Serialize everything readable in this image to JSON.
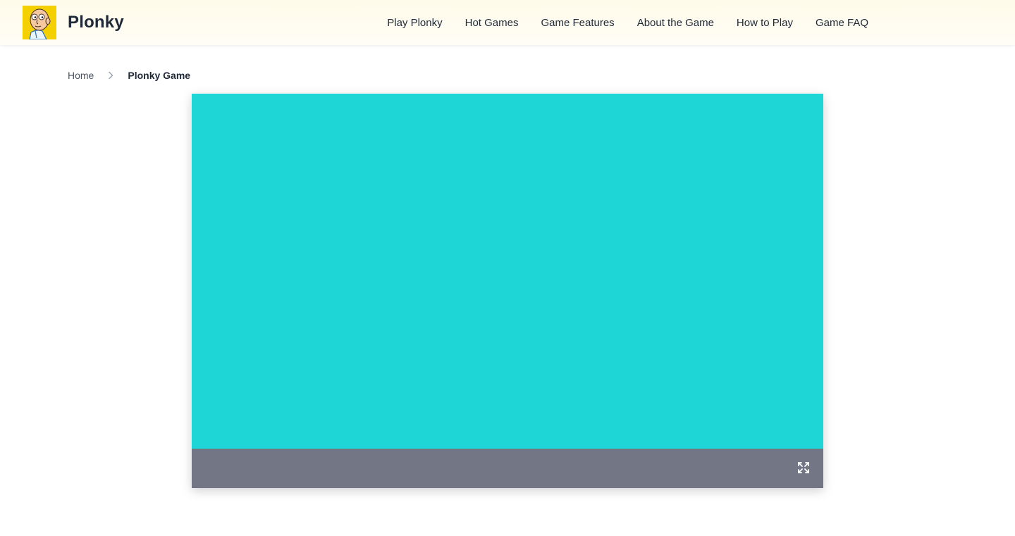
{
  "site": {
    "brand": "Plonky",
    "logo_icon": "plonky-character-logo",
    "logo_bg_color": "#f5d000"
  },
  "nav": {
    "items": [
      {
        "label": "Play Plonky"
      },
      {
        "label": "Hot Games"
      },
      {
        "label": "Game Features"
      },
      {
        "label": "About the Game"
      },
      {
        "label": "How to Play"
      },
      {
        "label": "Game FAQ"
      }
    ]
  },
  "breadcrumb": {
    "home": "Home",
    "separator_icon": "chevron-right-icon",
    "current": "Plonky Game"
  },
  "game": {
    "canvas_color": "#1fd6d6",
    "bar_color": "#737785",
    "fullscreen_icon": "expand-icon"
  }
}
